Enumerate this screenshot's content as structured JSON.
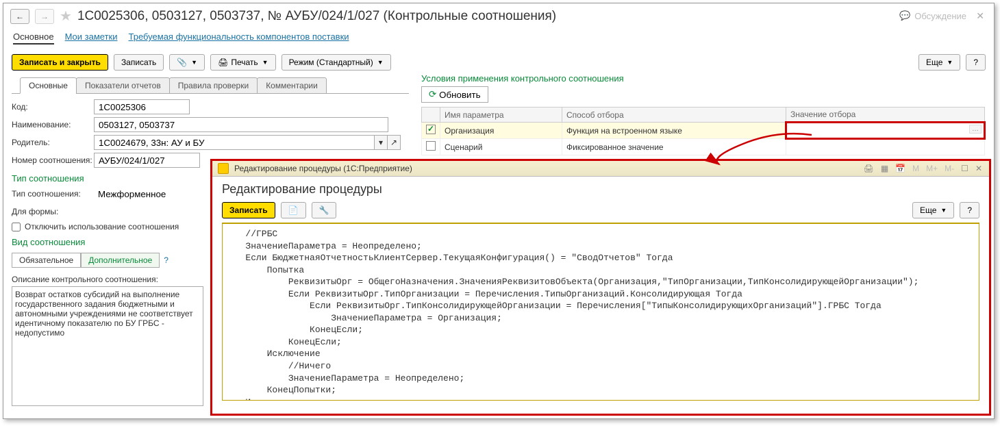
{
  "header": {
    "title": "1С0025306, 0503127, 0503737, № АУБУ/024/1/027 (Контрольные соотношения)",
    "discussion_label": "Обсуждение"
  },
  "nav_links": {
    "main": "Основное",
    "notes": "Мои заметки",
    "required": "Требуемая функциональность компонентов поставки"
  },
  "toolbar": {
    "save_close": "Записать и закрыть",
    "save": "Записать",
    "print": "Печать",
    "mode": "Режим (Стандартный)",
    "more": "Еще"
  },
  "tabs": {
    "t1": "Основные",
    "t2": "Показатели отчетов",
    "t3": "Правила проверки",
    "t4": "Комментарии"
  },
  "fields": {
    "code_label": "Код:",
    "code_value": "1С0025306",
    "name_label": "Наименование:",
    "name_value": "0503127, 0503737",
    "parent_label": "Родитель:",
    "parent_value": "1С0024679, 33н: АУ и БУ",
    "num_label": "Номер соотношения:",
    "num_value": "АУБУ/024/1/027"
  },
  "type_section": {
    "title": "Тип соотношения",
    "type_label": "Тип соотношения:",
    "type_value": "Межформенное",
    "form_label": "Для формы:",
    "form_value": "",
    "disable_label": "Отключить использование соотношения"
  },
  "kind_section": {
    "title": "Вид соотношения",
    "mandatory": "Обязательное",
    "additional": "Дополнительное"
  },
  "desc": {
    "label": "Описание контрольного соотношения:",
    "text": "Возврат остатков субсидий на выполнение государственного задания бюджетными и автономными учреждениями не соответствует идентичному показателю по БУ ГРБС - недопустимо"
  },
  "conditions": {
    "title": "Условия применения контрольного соотношения",
    "refresh": "Обновить",
    "col_name": "Имя параметра",
    "col_method": "Способ отбора",
    "col_value": "Значение отбора",
    "rows": [
      {
        "checked": true,
        "name": "Организация",
        "method": "Функция на встроенном языке",
        "value": ""
      },
      {
        "checked": false,
        "name": "Сценарий",
        "method": "Фиксированное значение",
        "value": ""
      }
    ]
  },
  "modal": {
    "titlebar": "Редактирование процедуры  (1С:Предприятие)",
    "heading": "Редактирование процедуры",
    "save": "Записать",
    "more": "Еще",
    "titlebar_icons": {
      "m": "M",
      "mplus": "M+",
      "mminus": "M-"
    },
    "code": "   //ГРБС\n   ЗначениеПараметра = Неопределено;\n   Если БюджетнаяОтчетностьКлиентСервер.ТекущаяКонфигурация() = \"СводОтчетов\" Тогда\n       Попытка\n           РеквизитыОрг = ОбщегоНазначения.ЗначенияРеквизитовОбъекта(Организация,\"ТипОрганизации,ТипКонсолидирующейОрганизации\");\n           Если РеквизитыОрг.ТипОрганизации = Перечисления.ТипыОрганизаций.Консолидирующая Тогда\n               Если РеквизитыОрг.ТипКонсолидирующейОрганизации = Перечисления[\"ТипыКонсолидирующихОрганизаций\"].ГРБС Тогда\n                   ЗначениеПараметра = Организация;\n               КонецЕсли;\n           КонецЕсли;\n       Исключение\n           //Ничего\n           ЗначениеПараметра = Неопределено;\n       КонецПопытки;\n   Иначе\n       ЗначениеПараметра = Неопределено;\n   КонецЕсли;"
  }
}
